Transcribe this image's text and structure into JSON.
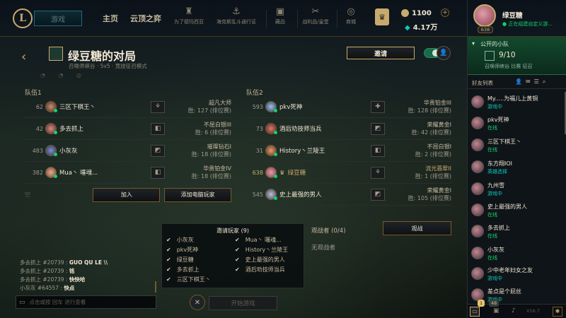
{
  "nav": {
    "play_label": "游戏",
    "home": "主页",
    "tft": "云顶之弈",
    "icons": [
      {
        "icon": "pillar-icon",
        "label": "为了德玛西亚"
      },
      {
        "icon": "bilgewater-icon",
        "label": "海克斯乱斗通行证"
      },
      {
        "icon": "collection-icon",
        "label": "藏品"
      },
      {
        "icon": "loot-icon",
        "label": "战利品/皇堂"
      },
      {
        "icon": "store-icon",
        "label": "商城"
      }
    ],
    "rp": "1100",
    "be": "4.17万"
  },
  "lobby": {
    "title": "绿豆糖的对局",
    "subtitle": "召唤师峡谷 · 5v5 · 竞技征召模式",
    "invite": "邀请"
  },
  "team1": {
    "label": "队伍1",
    "players": [
      {
        "level": "62",
        "name": "三区下棋王丶",
        "pos": "⚘",
        "tier": "超凡大师",
        "wins": "胜: 127",
        "note": "(排位赛)"
      },
      {
        "level": "42",
        "name": "多去抓上",
        "pos": "◧",
        "tier": "不屈白银III",
        "wins": "胜: 6",
        "note": "(排位赛)"
      },
      {
        "level": "483",
        "name": "小灰灰",
        "pos": "◩",
        "tier": "璀璨钻石I",
        "wins": "胜: 18",
        "note": "(排位赛)"
      },
      {
        "level": "382",
        "name": "Mua丶 噻魂...",
        "pos": "◧",
        "tier": "华贵铂金IV",
        "wins": "胜: 18",
        "note": "(排位赛)"
      }
    ],
    "empty_level": "空",
    "add": "加入",
    "add_bot": "添加电脑玩家"
  },
  "team2": {
    "label": "队伍2",
    "players": [
      {
        "level": "593",
        "name": "pkv死神",
        "pos": "✚",
        "tier": "华贵铂金III",
        "wins": "胜: 128",
        "note": "(排位赛)"
      },
      {
        "level": "73",
        "name": "酒后劝技师当兵",
        "pos": "◩",
        "tier": "荣耀黄金I",
        "wins": "胜: 42",
        "note": "(排位赛)"
      },
      {
        "level": "31",
        "name": "History丶兰陵王",
        "pos": "◧",
        "tier": "不屈白银I",
        "wins": "胜: 2",
        "note": "(排位赛)"
      },
      {
        "level": "638",
        "name": "绿豆糖",
        "pos": "⚘",
        "tier": "流光翡翠II",
        "wins": "胜: 1",
        "note": "(排位赛)",
        "self": true
      },
      {
        "level": "545",
        "name": "史上最强的男人",
        "pos": "◩",
        "tier": "荣耀黄金I",
        "wins": "胜: 105",
        "note": "(排位赛)"
      }
    ]
  },
  "invited": {
    "header": "邀请玩家 (9)",
    "players": [
      "小灰灰",
      "Mua丶 噻魂...",
      "pkv死神",
      "History丶兰陵王",
      "绿豆糖",
      "史上最强的男人",
      "多去抓上",
      "酒后劝技师当兵",
      "三区下棋王丶"
    ]
  },
  "spectators": {
    "title": "观战者 (0/4)",
    "none": "无观战者",
    "button": "观战"
  },
  "chat": {
    "lines": [
      {
        "who": "多去抓上 #20739",
        "msg": "GUO QU LE \\\\"
      },
      {
        "who": "多去抓上 #20739",
        "msg": "铭"
      },
      {
        "who": "多去抓上 #20739",
        "msg": "快快哈"
      },
      {
        "who": "小灰灰 #64557",
        "msg": "快点"
      }
    ],
    "placeholder": "点击或按 回车 进行查看"
  },
  "start": {
    "label": "开始游戏"
  },
  "social": {
    "me_name": "绿豆糖",
    "me_status": "正在组建自定义游...",
    "me_level": "638",
    "party_title": "公开的小队",
    "party_count": "9/10",
    "party_mode": "召唤师峡谷 比赛 征召",
    "friends_label": "好友列表",
    "friends": [
      {
        "name": "My.....为福儿上黄铜",
        "status": "游戏中",
        "cls": "ingame"
      },
      {
        "name": "pkv死神",
        "status": "在线",
        "cls": "online"
      },
      {
        "name": "三区下棋王丶",
        "status": "在线",
        "cls": "online"
      },
      {
        "name": "东方翔IOI",
        "status": "英雄选择",
        "cls": "champ"
      },
      {
        "name": "九州雪",
        "status": "游戏中",
        "cls": "ingame"
      },
      {
        "name": "史上最强的男人",
        "status": "在线",
        "cls": "online"
      },
      {
        "name": "多去抓上",
        "status": "在线",
        "cls": "online"
      },
      {
        "name": "小灰灰",
        "status": "在线",
        "cls": "online"
      },
      {
        "name": "少中老年妇女之友",
        "status": "游戏中",
        "cls": "ingame"
      },
      {
        "name": "差点是个屁丝",
        "status": "游戏中",
        "cls": "ingame"
      }
    ],
    "badge_yellow": "1",
    "badge_grey": "48",
    "version": "V16.7"
  }
}
